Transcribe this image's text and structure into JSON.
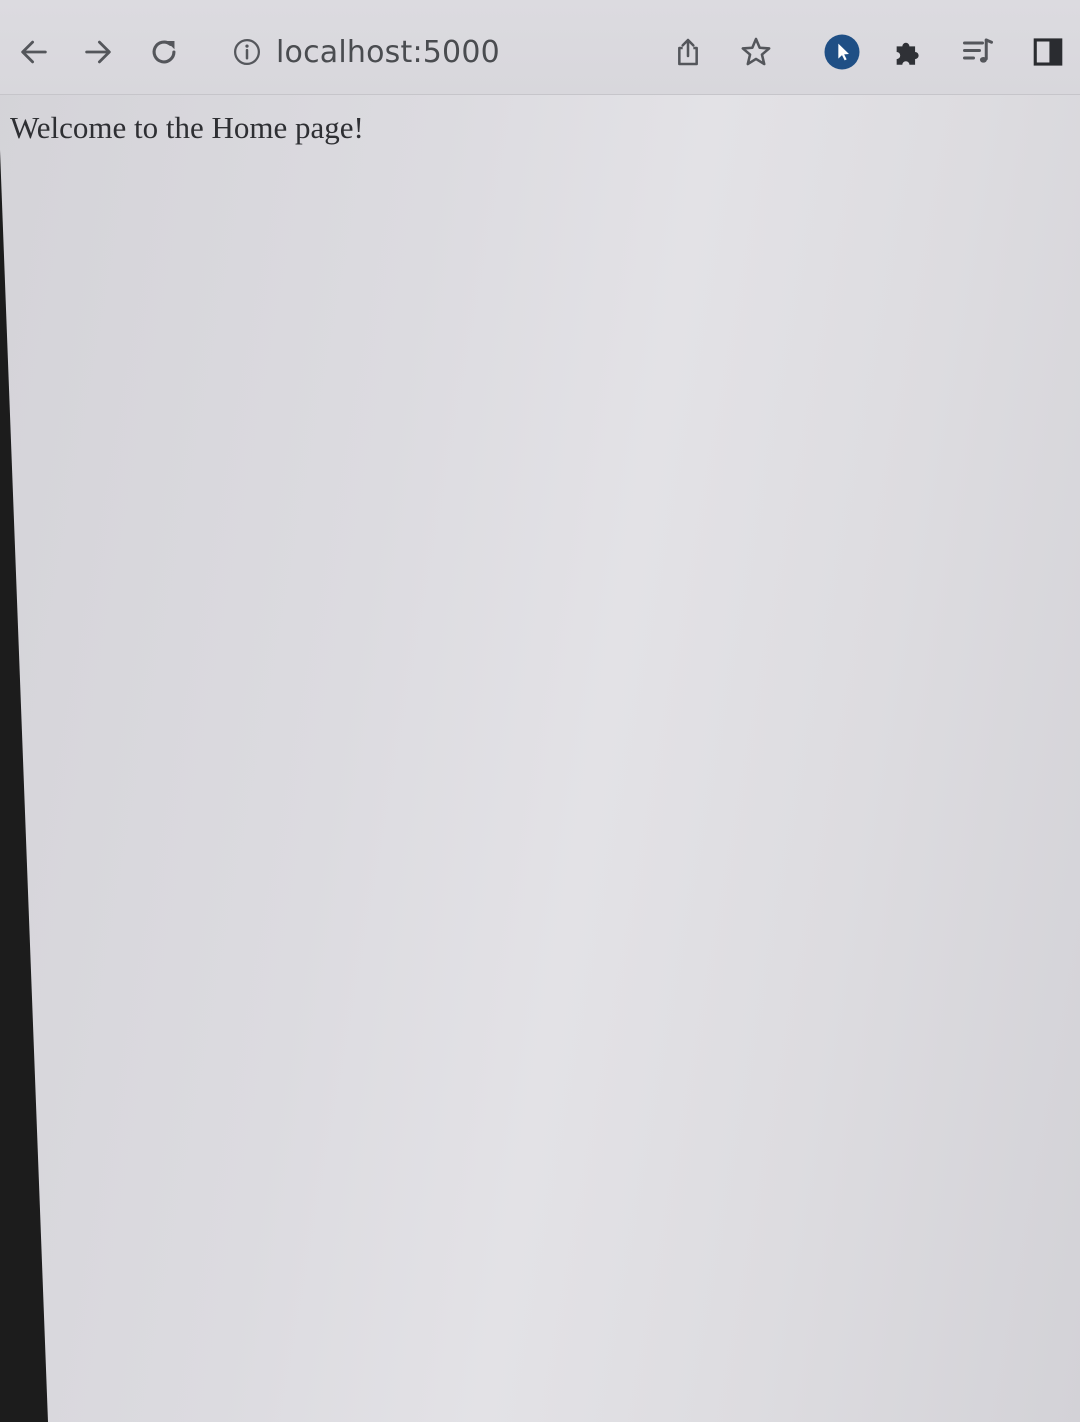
{
  "browser": {
    "address_bar": {
      "url": "localhost:5000"
    },
    "toolbar_icons": {
      "back": "arrow-left-icon",
      "forward": "arrow-right-icon",
      "reload": "reload-icon",
      "site_info": "info-circle-icon",
      "share": "share-icon",
      "bookmark": "star-outline-icon",
      "profile_extension": "cursor-extension-icon",
      "extensions": "puzzle-piece-icon",
      "media_queue": "playlist-icon",
      "side_panel": "side-panel-icon"
    },
    "accent_color": "#1f4f85"
  },
  "page": {
    "message": "Welcome to the Home page!"
  }
}
